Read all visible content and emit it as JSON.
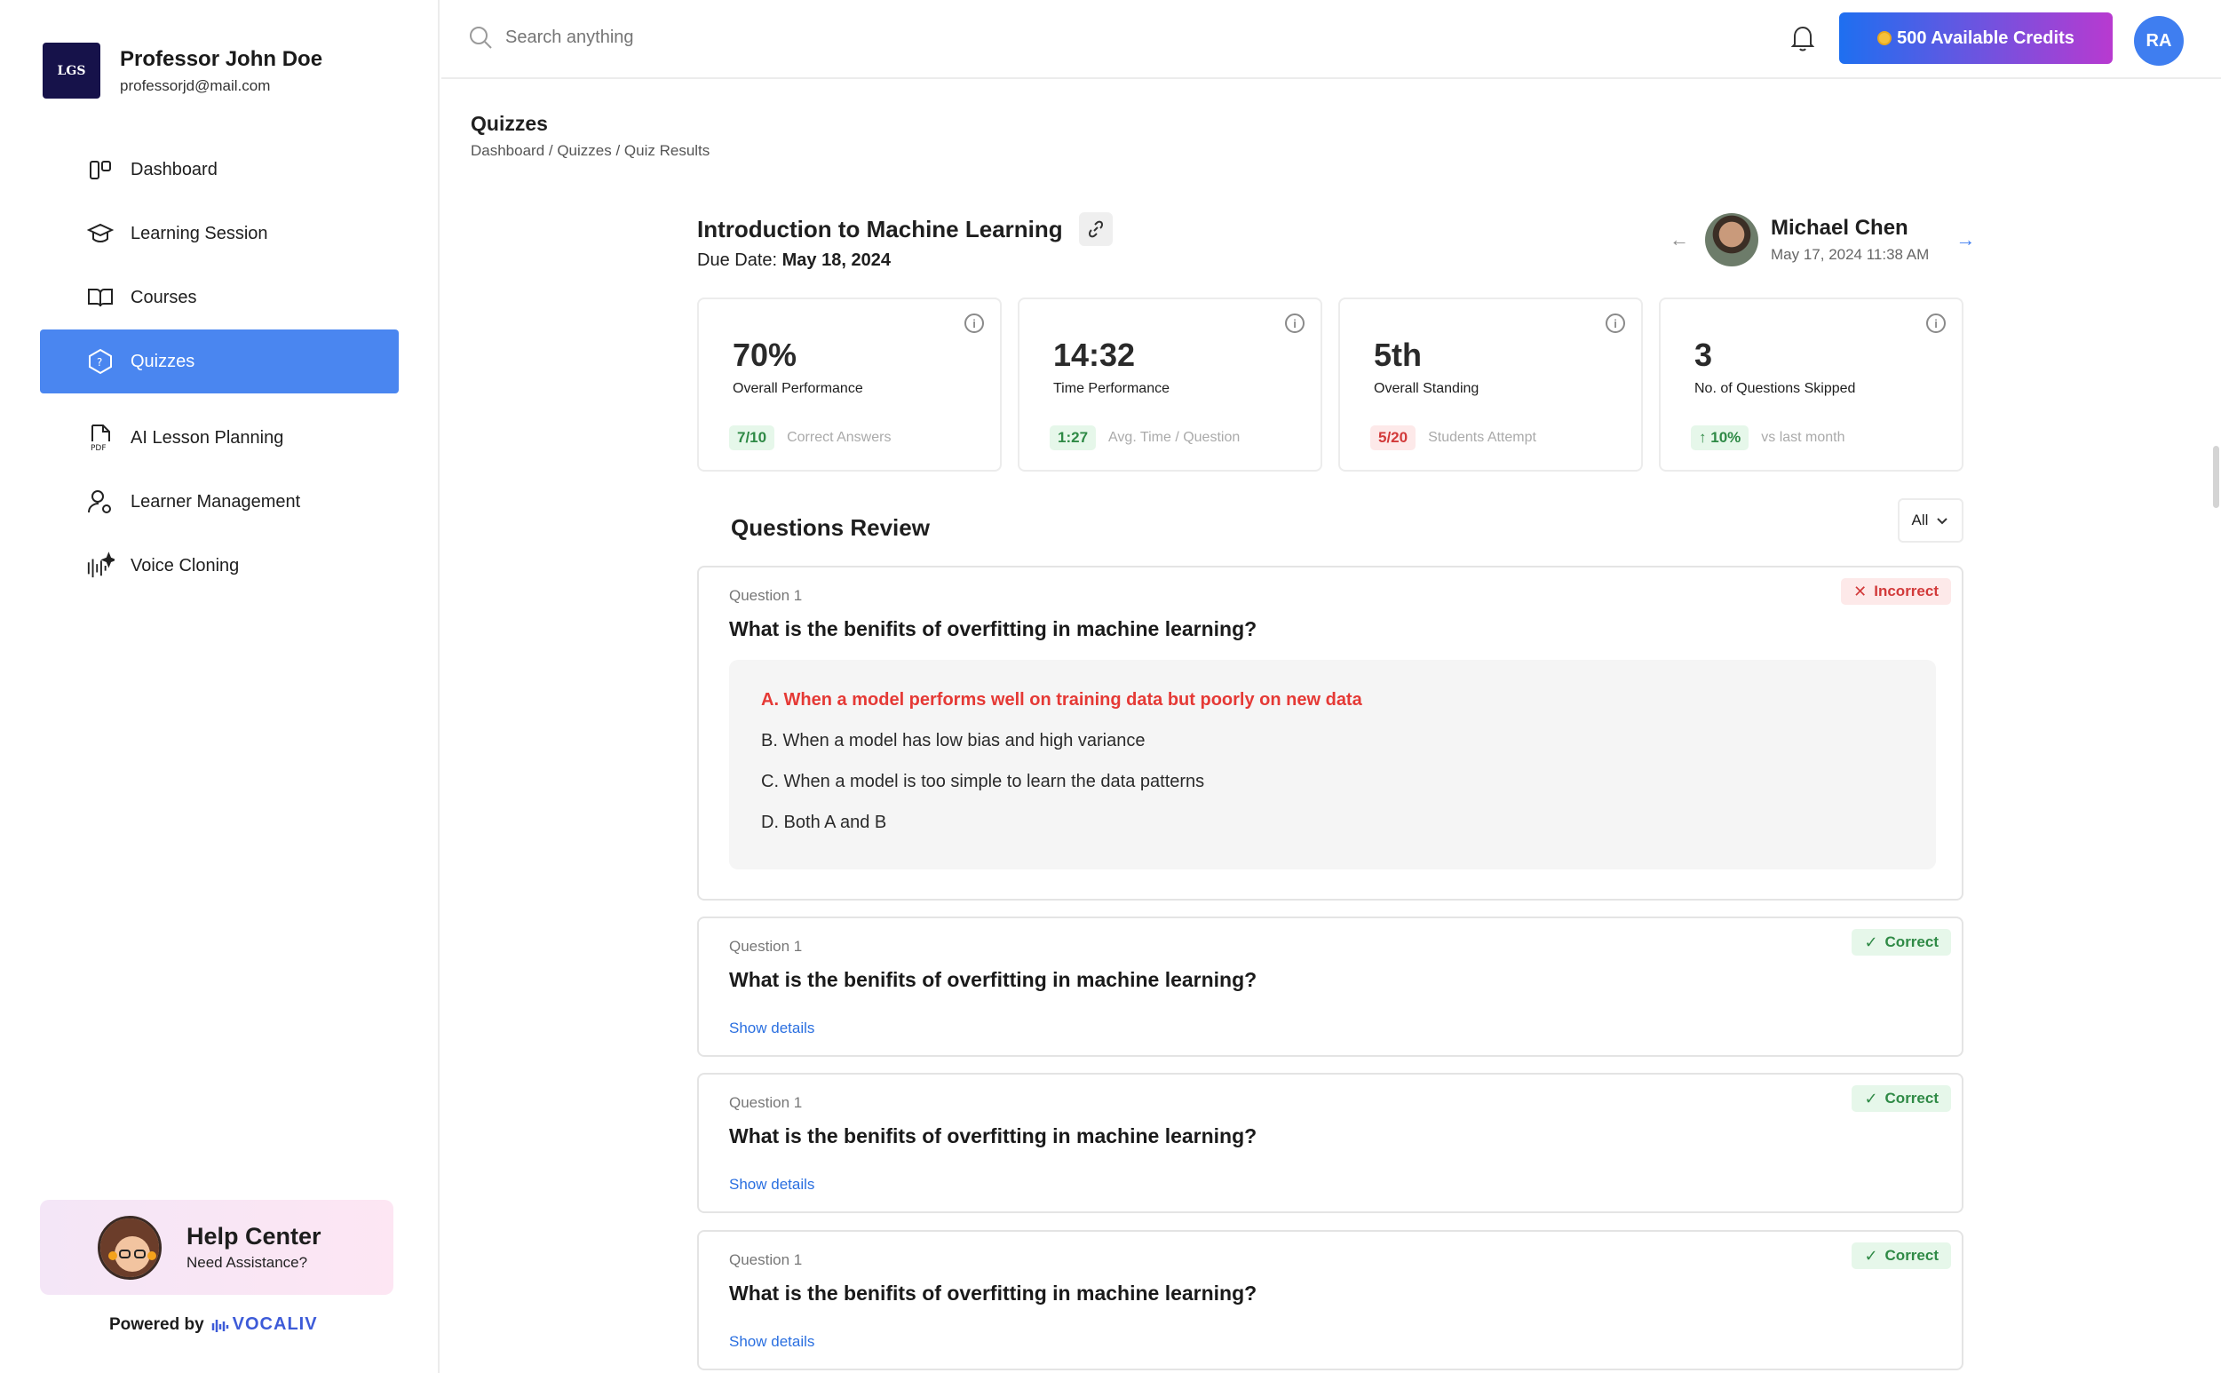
{
  "profile": {
    "logo_text": "LGS",
    "name": "Professor John Doe",
    "email": "professorjd@mail.com"
  },
  "nav": {
    "items": [
      {
        "label": "Dashboard",
        "icon": "dashboard-icon"
      },
      {
        "label": "Learning Session",
        "icon": "graduation-cap-icon"
      },
      {
        "label": "Courses",
        "icon": "book-icon"
      },
      {
        "label": "Quizzes",
        "icon": "quiz-hexagon-icon",
        "active": true
      },
      {
        "label": "AI Lesson Planning",
        "icon": "pdf-file-icon"
      },
      {
        "label": "Learner Management",
        "icon": "user-settings-icon"
      },
      {
        "label": "Voice Cloning",
        "icon": "voice-wave-icon"
      }
    ]
  },
  "help": {
    "title": "Help Center",
    "subtitle": "Need Assistance?"
  },
  "powered": {
    "label": "Powered by",
    "brand": "VOCALIV"
  },
  "topbar": {
    "search_placeholder": "Search anything",
    "credits_label": "500 Available Credits",
    "user_initials": "RA"
  },
  "page": {
    "title": "Quizzes",
    "breadcrumb": "Dashboard / Quizzes / Quiz Results"
  },
  "quiz": {
    "title": "Introduction to Machine Learning",
    "due_label": "Due Date:",
    "due_date": "May 18, 2024"
  },
  "student": {
    "name": "Michael Chen",
    "date": "May 17, 2024  11:38 AM"
  },
  "stats": [
    {
      "value": "70%",
      "label": "Overall Performance",
      "pill": "7/10",
      "pill_color": "green",
      "note": "Correct Answers"
    },
    {
      "value": "14:32",
      "label": "Time Performance",
      "pill": "1:27",
      "pill_color": "green",
      "note": "Avg. Time / Question"
    },
    {
      "value": "5th",
      "label": "Overall Standing",
      "pill": "5/20",
      "pill_color": "red",
      "note": "Students Attempt"
    },
    {
      "value": "3",
      "label": "No. of Questions Skipped",
      "pill": "10%",
      "pill_color": "green",
      "pill_prefix": "↑",
      "note": "vs last month"
    }
  ],
  "review": {
    "title": "Questions Review",
    "filter": "All",
    "questions": [
      {
        "number": "Question 1",
        "text": "What is the benifits of overfitting in machine learning?",
        "status": "Incorrect",
        "options": [
          "A. When a model performs well on training data but poorly on new data",
          "B. When a model has low bias and high variance",
          "C. When a model is too simple to learn the data patterns",
          "D. Both A and B"
        ]
      },
      {
        "number": "Question 1",
        "text": "What is the benifits of overfitting in machine learning?",
        "status": "Correct",
        "link": "Show details"
      },
      {
        "number": "Question 1",
        "text": "What is the benifits of overfitting in machine learning?",
        "status": "Correct",
        "link": "Show details"
      },
      {
        "number": "Question 1",
        "text": "What is the benifits of overfitting in machine learning?",
        "status": "Correct",
        "link": "Show details"
      }
    ]
  },
  "colors": {
    "accent": "#4a86f0",
    "correct": "#2f8a46",
    "incorrect": "#d23a3a"
  }
}
